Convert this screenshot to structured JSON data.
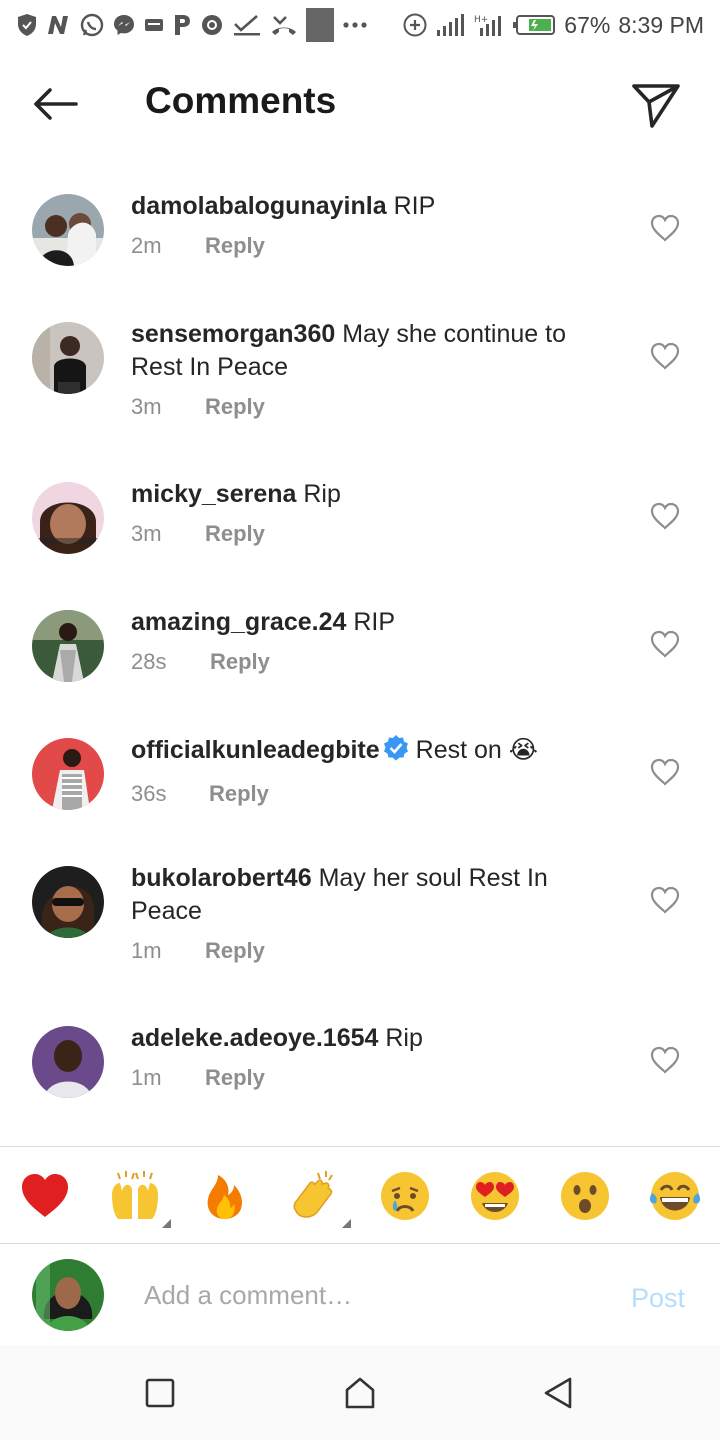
{
  "status_bar": {
    "left_icons": [
      "shield-icon",
      "n-icon",
      "whatsapp-icon",
      "messenger-icon",
      "message-icon",
      "p-icon",
      "chrome-icon",
      "check-icon",
      "missed-call-icon",
      "image-icon",
      "more-icon"
    ],
    "battery": "67%",
    "time": "8:39 PM"
  },
  "header": {
    "title": "Comments"
  },
  "comments": [
    {
      "username": "damolabalogunayinla",
      "text": "RIP",
      "time": "2m",
      "reply": "Reply"
    },
    {
      "username": "sensemorgan360",
      "text": "May she continue to Rest In Peace",
      "time": "3m",
      "reply": "Reply"
    },
    {
      "username": "micky_serena",
      "text": "Rip",
      "time": "3m",
      "reply": "Reply"
    },
    {
      "username": "amazing_grace.24",
      "text": "RIP",
      "time": "28s",
      "reply": "Reply"
    },
    {
      "username": "officialkunleadegbite",
      "text": "Rest on 😭",
      "time": "36s",
      "reply": "Reply",
      "verified": true
    },
    {
      "username": "bukolarobert46",
      "text": "May her soul Rest In Peace",
      "time": "1m",
      "reply": "Reply"
    },
    {
      "username": "adeleke.adeoye.1654",
      "text": "Rip",
      "time": "1m",
      "reply": "Reply"
    }
  ],
  "emoji_bar": [
    "red-heart",
    "raising-hands",
    "fire",
    "clapping-hands",
    "crying-face",
    "heart-eyes",
    "astonished-face",
    "tears-of-joy"
  ],
  "composer": {
    "placeholder": "Add a comment…",
    "post_label": "Post"
  },
  "colors": {
    "text": "#262626",
    "secondary": "#8e8e8e",
    "post_disabled": "#b2dffc",
    "verified": "#3897f0"
  }
}
